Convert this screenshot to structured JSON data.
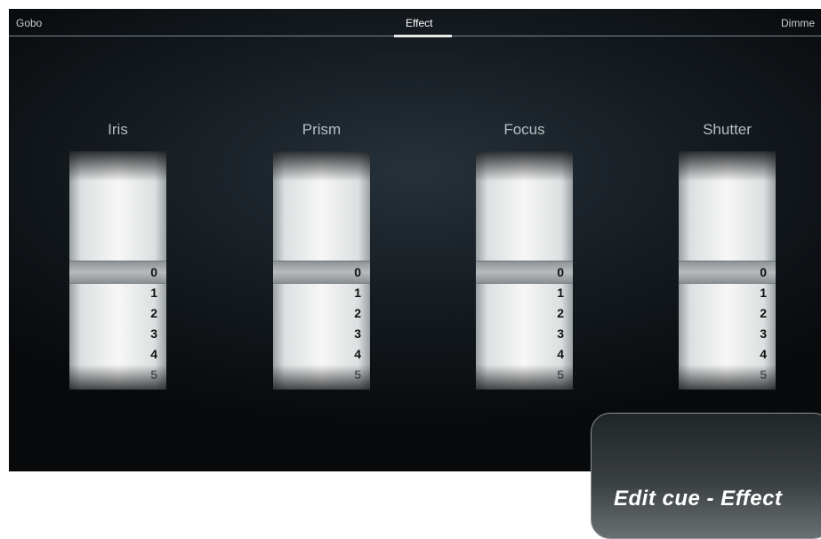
{
  "tabs": {
    "gobo": "Gobo",
    "effect": "Effect",
    "dimmer": "Dimme"
  },
  "columns": {
    "iris": {
      "label": "Iris",
      "values": [
        "0",
        "1",
        "2",
        "3",
        "4",
        "5"
      ],
      "selected": "0"
    },
    "prism": {
      "label": "Prism",
      "values": [
        "0",
        "1",
        "2",
        "3",
        "4",
        "5"
      ],
      "selected": "0"
    },
    "focus": {
      "label": "Focus",
      "values": [
        "0",
        "1",
        "2",
        "3",
        "4",
        "5"
      ],
      "selected": "0"
    },
    "shutter": {
      "label": "Shutter",
      "values": [
        "0",
        "1",
        "2",
        "3",
        "4",
        "5"
      ],
      "selected": "0"
    }
  },
  "edit_panel": {
    "title": "Edit cue - Effect"
  }
}
